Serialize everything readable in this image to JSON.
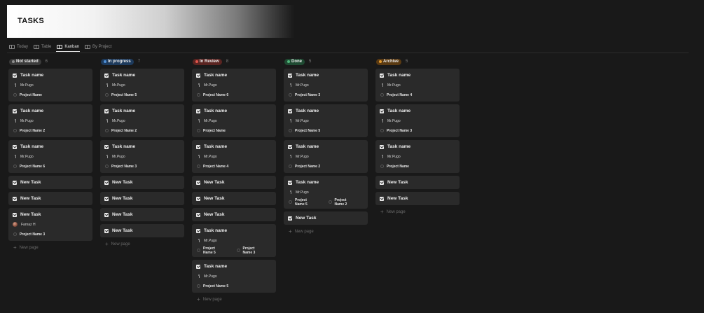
{
  "page": {
    "title": "TASKS"
  },
  "views": [
    {
      "label": "Today",
      "icon": "table-icon",
      "active": false
    },
    {
      "label": "Table",
      "icon": "table-icon",
      "active": false
    },
    {
      "label": "Kanban",
      "icon": "board-icon",
      "active": true
    },
    {
      "label": "By Project",
      "icon": "board-icon",
      "active": false
    }
  ],
  "new_page_label": "New page",
  "columns": [
    {
      "status": "Not started",
      "count": "6",
      "pill_bg": "#3b3b3b",
      "dot": "#8e8e8e",
      "cards": [
        {
          "title": "Task name",
          "assignee": "Mr.Pugo",
          "projects": [
            "Project Name"
          ]
        },
        {
          "title": "Task name",
          "assignee": "Mr.Pugo",
          "projects": [
            "Project Name 2"
          ]
        },
        {
          "title": "Task name",
          "assignee": "Mr.Pugo",
          "projects": [
            "Project Name 6"
          ]
        },
        {
          "title": "New Task"
        },
        {
          "title": "New Task"
        },
        {
          "title": "New Task",
          "assignee": "Farnaz H",
          "avatar": true,
          "projects": [
            "Project Name 3"
          ]
        }
      ]
    },
    {
      "status": "In progress",
      "count": "7",
      "pill_bg": "#1d3a5c",
      "dot": "#4f8fd6",
      "cards": [
        {
          "title": "Task name",
          "assignee": "Mr.Pugo",
          "projects": [
            "Project Name 5"
          ]
        },
        {
          "title": "Task name",
          "assignee": "Mr.Pugo",
          "projects": [
            "Project Name 2"
          ]
        },
        {
          "title": "Task name",
          "assignee": "Mr.Pugo",
          "projects": [
            "Project Name 3"
          ]
        },
        {
          "title": "New Task"
        },
        {
          "title": "New Task"
        },
        {
          "title": "New Task"
        },
        {
          "title": "New Task"
        }
      ]
    },
    {
      "status": "In Review",
      "count": "8",
      "pill_bg": "#5a2421",
      "dot": "#e0564c",
      "cards": [
        {
          "title": "Task name",
          "assignee": "Mr.Pugo",
          "projects": [
            "Project Name 6"
          ]
        },
        {
          "title": "Task name",
          "assignee": "Mr.Pugo",
          "projects": [
            "Project Name"
          ]
        },
        {
          "title": "Task name",
          "assignee": "Mr.Pugo",
          "projects": [
            "Project Name 4"
          ]
        },
        {
          "title": "New Task"
        },
        {
          "title": "New Task"
        },
        {
          "title": "New Task"
        },
        {
          "title": "Task name",
          "assignee": "Mr.Pugo",
          "projects": [
            "Project Name 5",
            "Project Name 3"
          ]
        },
        {
          "title": "Task name",
          "assignee": "Mr.Pugo",
          "projects": [
            "Project Name 5"
          ]
        }
      ]
    },
    {
      "status": "Done",
      "count": "5",
      "pill_bg": "#1f4a32",
      "dot": "#4fb57a",
      "cards": [
        {
          "title": "Task name",
          "assignee": "Mr.Pugo",
          "projects": [
            "Project Name 3"
          ]
        },
        {
          "title": "Task name",
          "assignee": "Mr.Pugo",
          "projects": [
            "Project Name 5"
          ]
        },
        {
          "title": "Task name",
          "assignee": "Mr.Pugo",
          "projects": [
            "Project Name 2"
          ]
        },
        {
          "title": "Task name",
          "assignee": "Mr.Pugo",
          "projects": [
            "Project Name 5",
            "Project Name 2"
          ]
        },
        {
          "title": "New Task"
        }
      ]
    },
    {
      "status": "Archive",
      "count": "5",
      "pill_bg": "#5a3a12",
      "dot": "#e29a2e",
      "cards": [
        {
          "title": "Task name",
          "assignee": "Mr.Pugo",
          "projects": [
            "Project Name 4"
          ]
        },
        {
          "title": "Task name",
          "assignee": "Mr.Pugo",
          "projects": [
            "Project Name 3"
          ]
        },
        {
          "title": "Task name",
          "assignee": "Mr.Pugo",
          "projects": [
            "Project Name"
          ]
        },
        {
          "title": "New Task"
        },
        {
          "title": "New Task"
        }
      ]
    }
  ]
}
